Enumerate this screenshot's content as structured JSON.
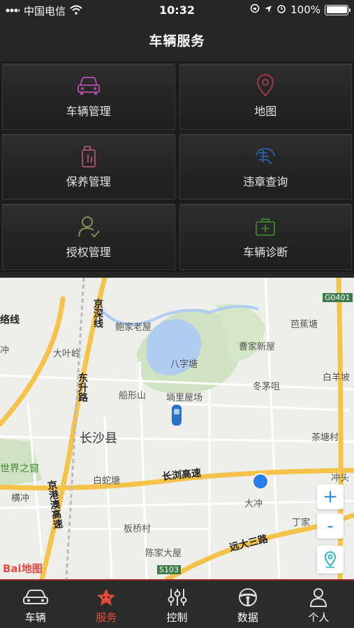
{
  "status_bar": {
    "carrier": "中国电信",
    "time": "10:32",
    "battery": "100%"
  },
  "header": {
    "title": "车辆服务"
  },
  "services": [
    {
      "label": "车辆管理",
      "icon": "car-icon",
      "color": "#a64ba6"
    },
    {
      "label": "地图",
      "icon": "map-pin-icon",
      "color": "#a23a46"
    },
    {
      "label": "保养管理",
      "icon": "oil-can-icon",
      "color": "#a34b6a"
    },
    {
      "label": "违章查询",
      "icon": "ticket-icon",
      "color": "#2c5c9a"
    },
    {
      "label": "授权管理",
      "icon": "user-check-icon",
      "color": "#8a8a5a"
    },
    {
      "label": "车辆诊断",
      "icon": "medkit-icon",
      "color": "#3a7a2a"
    }
  ],
  "map": {
    "labels": {
      "jingzhu_line": "京深线",
      "luoxian": "络线",
      "baojia": "鲍家老屋",
      "bajiao": "芭蕉塘",
      "caojia": "曹家新屋",
      "bazitang": "八字塘",
      "daye": "大叶岭",
      "dongsheng": "东升路",
      "chong": "冲",
      "chuanxing": "船形山",
      "dongmao": "冬茅咀",
      "baiyang": "白羊坡",
      "wanli": "埫里屋场",
      "changsha_county": "长沙县",
      "chatang": "茶塘村",
      "world_window": "世界之窗",
      "baishe": "白蛇塘",
      "changliu": "长浏高速",
      "chongtou": "冲头",
      "hengchong": "横冲",
      "dachong": "大冲",
      "jinggang": "京港澳高速",
      "dingjia": "丁家",
      "banqiao": "板桥村",
      "yuanda": "远大三路",
      "chenjia": "陈家大屋",
      "g0401": "G0401",
      "s103": "S103",
      "changsha": "长沙县"
    },
    "zoom_in": "+",
    "zoom_out": "-",
    "logo": "Bai地图"
  },
  "tabs": [
    {
      "label": "车辆",
      "icon": "car-outline-icon",
      "active": false
    },
    {
      "label": "服务",
      "icon": "star-badge-icon",
      "active": true
    },
    {
      "label": "控制",
      "icon": "sliders-icon",
      "active": false
    },
    {
      "label": "数据",
      "icon": "steering-wheel-icon",
      "active": false
    },
    {
      "label": "个人",
      "icon": "person-icon",
      "active": false
    }
  ]
}
